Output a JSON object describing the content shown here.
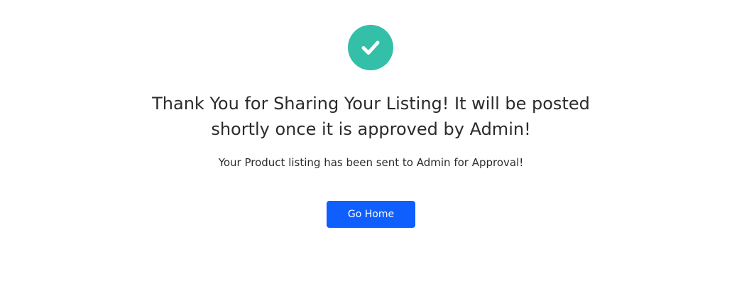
{
  "confirmation": {
    "icon": "check-circle-icon",
    "title_line1": "Thank You for Sharing Your Listing! It will be posted",
    "title_line2": "shortly once it is approved by Admin!",
    "message": "Your Product listing has been sent to Admin for Approval!",
    "button_label": "Go Home"
  },
  "colors": {
    "success": "#33BFA8",
    "primary": "#0F5FFF",
    "text": "#2B2B2B",
    "background": "#FFFFFF"
  }
}
